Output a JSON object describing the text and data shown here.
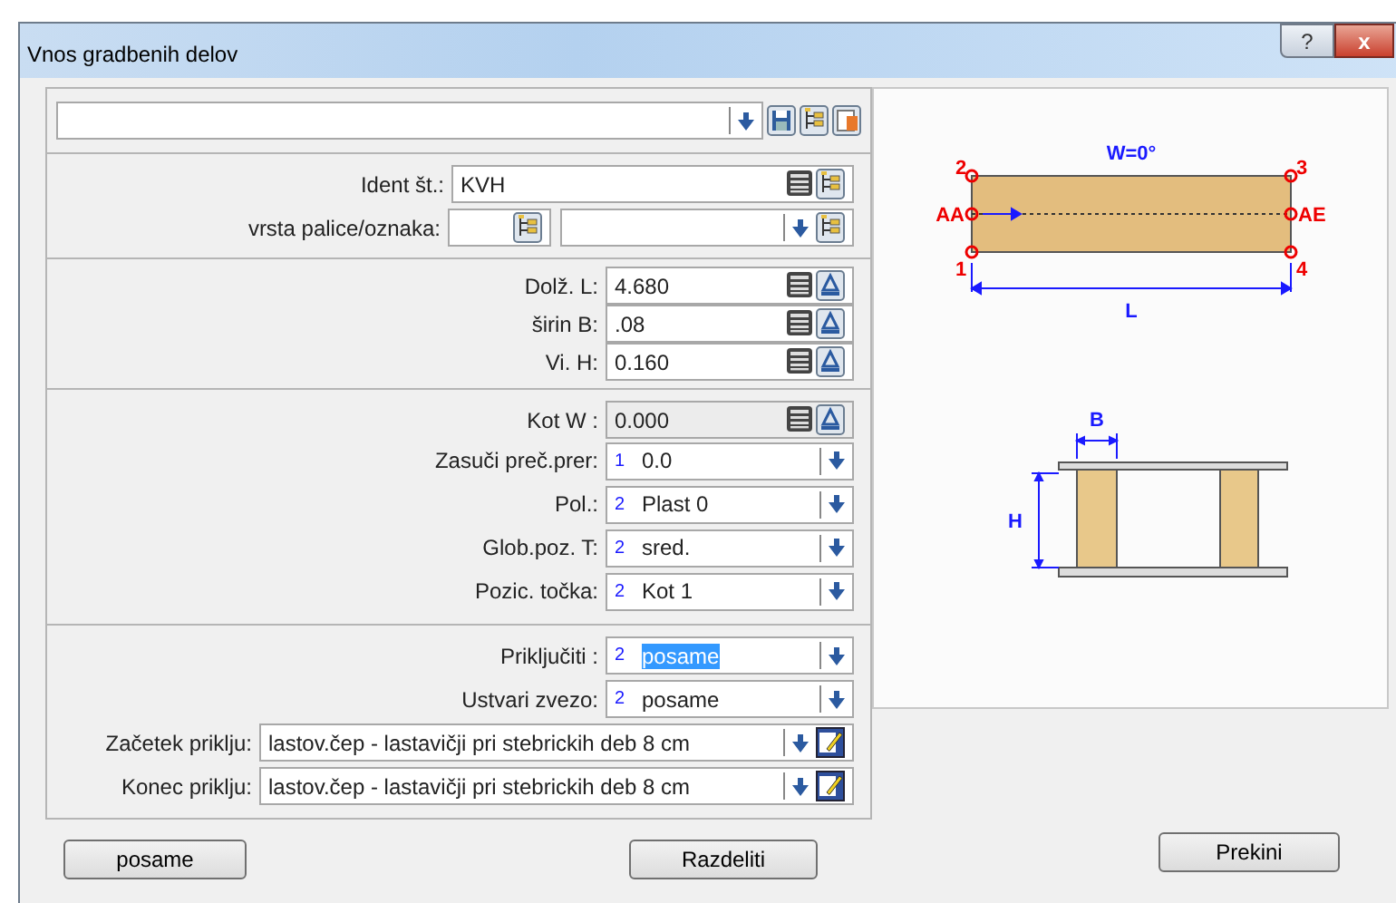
{
  "window": {
    "title": "Vnos gradbenih delov",
    "help_glyph": "?",
    "close_glyph": "x"
  },
  "sections": [
    [
      {
        "kind": "ident",
        "label": "Ident št.:",
        "value": "KVH"
      },
      {
        "kind": "pair",
        "label": "vrsta palice/oznaka:"
      }
    ],
    [
      {
        "kind": "dimension",
        "label": "Dolž. L:",
        "value": "4.680",
        "disabled": false
      },
      {
        "kind": "dimension",
        "label": "širin B:",
        "value": ".08",
        "disabled": false
      },
      {
        "kind": "dimension",
        "label": "Vi. H:",
        "value": "0.160",
        "disabled": false
      }
    ],
    [
      {
        "kind": "dimension",
        "label": "Kot W :",
        "value": "0.000",
        "disabled": true
      },
      {
        "kind": "combo",
        "label": "Zasuči preč.prer:",
        "index": "1",
        "value": "0.0",
        "selected": false
      },
      {
        "kind": "combo",
        "label": "Pol.:",
        "index": "2",
        "value": "Plast 0",
        "selected": false
      },
      {
        "kind": "combo",
        "label": "Glob.poz. T:",
        "index": "2",
        "value": "sred.",
        "selected": false
      },
      {
        "kind": "combo",
        "label": "Pozic. točka:",
        "index": "2",
        "value": "Kot 1",
        "selected": false
      }
    ],
    [
      {
        "kind": "combo",
        "label": "Priključiti :",
        "index": "2",
        "value": "posame",
        "selected": true
      },
      {
        "kind": "combo",
        "label": "Ustvari zvezo:",
        "index": "2",
        "value": "posame",
        "selected": false
      },
      {
        "kind": "link",
        "label": "Začetek priklju:",
        "value": "lastov.čep - lastavičji pri stebrickih deb 8 cm"
      },
      {
        "kind": "link",
        "label": "Konec priklju:",
        "value": "lastov.čep - lastavičji pri stebrickih deb 8 cm"
      }
    ]
  ],
  "diagram": {
    "angle_label": "W=0°",
    "corner_labels": [
      "2",
      "3",
      "1",
      "4"
    ],
    "axis_start": "AA",
    "axis_end": "AE",
    "length_label": "L",
    "width_label": "B",
    "height_label": "H"
  },
  "buttons": [
    "posame",
    "Razdeliti",
    "Prekini"
  ]
}
